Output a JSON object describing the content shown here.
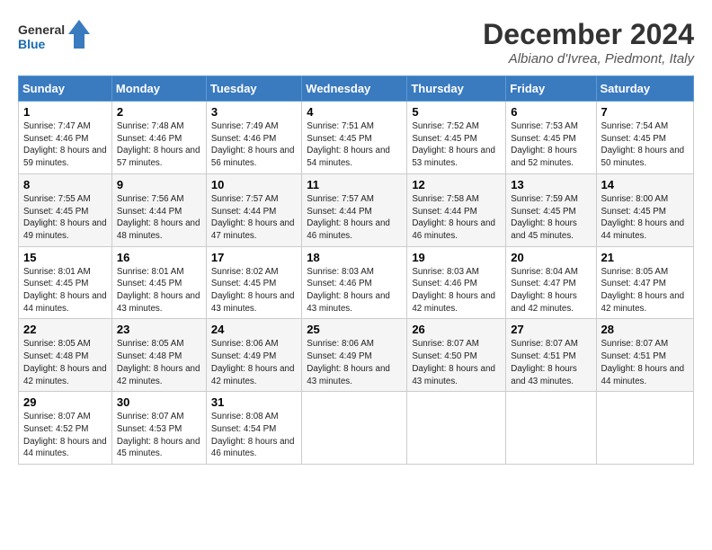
{
  "header": {
    "logo_line1": "General",
    "logo_line2": "Blue",
    "month": "December 2024",
    "location": "Albiano d'Ivrea, Piedmont, Italy"
  },
  "columns": [
    "Sunday",
    "Monday",
    "Tuesday",
    "Wednesday",
    "Thursday",
    "Friday",
    "Saturday"
  ],
  "weeks": [
    [
      {
        "day": "1",
        "sunrise": "7:47 AM",
        "sunset": "4:46 PM",
        "daylight": "8 hours and 59 minutes."
      },
      {
        "day": "2",
        "sunrise": "7:48 AM",
        "sunset": "4:46 PM",
        "daylight": "8 hours and 57 minutes."
      },
      {
        "day": "3",
        "sunrise": "7:49 AM",
        "sunset": "4:46 PM",
        "daylight": "8 hours and 56 minutes."
      },
      {
        "day": "4",
        "sunrise": "7:51 AM",
        "sunset": "4:45 PM",
        "daylight": "8 hours and 54 minutes."
      },
      {
        "day": "5",
        "sunrise": "7:52 AM",
        "sunset": "4:45 PM",
        "daylight": "8 hours and 53 minutes."
      },
      {
        "day": "6",
        "sunrise": "7:53 AM",
        "sunset": "4:45 PM",
        "daylight": "8 hours and 52 minutes."
      },
      {
        "day": "7",
        "sunrise": "7:54 AM",
        "sunset": "4:45 PM",
        "daylight": "8 hours and 50 minutes."
      }
    ],
    [
      {
        "day": "8",
        "sunrise": "7:55 AM",
        "sunset": "4:45 PM",
        "daylight": "8 hours and 49 minutes."
      },
      {
        "day": "9",
        "sunrise": "7:56 AM",
        "sunset": "4:44 PM",
        "daylight": "8 hours and 48 minutes."
      },
      {
        "day": "10",
        "sunrise": "7:57 AM",
        "sunset": "4:44 PM",
        "daylight": "8 hours and 47 minutes."
      },
      {
        "day": "11",
        "sunrise": "7:57 AM",
        "sunset": "4:44 PM",
        "daylight": "8 hours and 46 minutes."
      },
      {
        "day": "12",
        "sunrise": "7:58 AM",
        "sunset": "4:44 PM",
        "daylight": "8 hours and 46 minutes."
      },
      {
        "day": "13",
        "sunrise": "7:59 AM",
        "sunset": "4:45 PM",
        "daylight": "8 hours and 45 minutes."
      },
      {
        "day": "14",
        "sunrise": "8:00 AM",
        "sunset": "4:45 PM",
        "daylight": "8 hours and 44 minutes."
      }
    ],
    [
      {
        "day": "15",
        "sunrise": "8:01 AM",
        "sunset": "4:45 PM",
        "daylight": "8 hours and 44 minutes."
      },
      {
        "day": "16",
        "sunrise": "8:01 AM",
        "sunset": "4:45 PM",
        "daylight": "8 hours and 43 minutes."
      },
      {
        "day": "17",
        "sunrise": "8:02 AM",
        "sunset": "4:45 PM",
        "daylight": "8 hours and 43 minutes."
      },
      {
        "day": "18",
        "sunrise": "8:03 AM",
        "sunset": "4:46 PM",
        "daylight": "8 hours and 43 minutes."
      },
      {
        "day": "19",
        "sunrise": "8:03 AM",
        "sunset": "4:46 PM",
        "daylight": "8 hours and 42 minutes."
      },
      {
        "day": "20",
        "sunrise": "8:04 AM",
        "sunset": "4:47 PM",
        "daylight": "8 hours and 42 minutes."
      },
      {
        "day": "21",
        "sunrise": "8:05 AM",
        "sunset": "4:47 PM",
        "daylight": "8 hours and 42 minutes."
      }
    ],
    [
      {
        "day": "22",
        "sunrise": "8:05 AM",
        "sunset": "4:48 PM",
        "daylight": "8 hours and 42 minutes."
      },
      {
        "day": "23",
        "sunrise": "8:05 AM",
        "sunset": "4:48 PM",
        "daylight": "8 hours and 42 minutes."
      },
      {
        "day": "24",
        "sunrise": "8:06 AM",
        "sunset": "4:49 PM",
        "daylight": "8 hours and 42 minutes."
      },
      {
        "day": "25",
        "sunrise": "8:06 AM",
        "sunset": "4:49 PM",
        "daylight": "8 hours and 43 minutes."
      },
      {
        "day": "26",
        "sunrise": "8:07 AM",
        "sunset": "4:50 PM",
        "daylight": "8 hours and 43 minutes."
      },
      {
        "day": "27",
        "sunrise": "8:07 AM",
        "sunset": "4:51 PM",
        "daylight": "8 hours and 43 minutes."
      },
      {
        "day": "28",
        "sunrise": "8:07 AM",
        "sunset": "4:51 PM",
        "daylight": "8 hours and 44 minutes."
      }
    ],
    [
      {
        "day": "29",
        "sunrise": "8:07 AM",
        "sunset": "4:52 PM",
        "daylight": "8 hours and 44 minutes."
      },
      {
        "day": "30",
        "sunrise": "8:07 AM",
        "sunset": "4:53 PM",
        "daylight": "8 hours and 45 minutes."
      },
      {
        "day": "31",
        "sunrise": "8:08 AM",
        "sunset": "4:54 PM",
        "daylight": "8 hours and 46 minutes."
      },
      null,
      null,
      null,
      null
    ]
  ]
}
